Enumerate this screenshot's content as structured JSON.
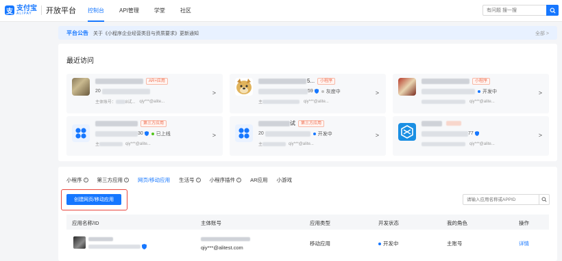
{
  "brand": {
    "logo_cn": "支付宝",
    "logo_en": "ALIPAY",
    "platform": "开放平台",
    "color": "#1677ff"
  },
  "nav": {
    "items": [
      {
        "label": "控制台",
        "active": true
      },
      {
        "label": "API管理",
        "active": false
      },
      {
        "label": "学堂",
        "active": false
      },
      {
        "label": "社区",
        "active": false
      }
    ]
  },
  "search": {
    "placeholder": "有问题 搜一搜",
    "icon": "search-icon"
  },
  "notice": {
    "tag": "平台公告",
    "text": "关于《小程序企业经营类目与资质要求》更新通知",
    "more": "全部 >"
  },
  "recent": {
    "title": "最近访问",
    "cards": [
      {
        "tag": "AR+应用",
        "id_prefix": "20",
        "status": "",
        "owner_prefix": "主体账号：",
        "owner_mid": "8试...",
        "email": "qiy***@alite..."
      },
      {
        "tag": "小程序",
        "id_prefix": "",
        "id_suffix": "59",
        "status": "灰度中",
        "status_color": "#bfbfbf",
        "owner_prefix": "主",
        "email": "qiy***@alite..."
      },
      {
        "tag": "小程序",
        "id_prefix": "",
        "status": "开发中",
        "status_color": "#1677ff",
        "owner_prefix": "",
        "email": "qiy***@alite..."
      },
      {
        "tag": "第三方应用",
        "id_prefix": "",
        "id_suffix": "30",
        "status": "已上线",
        "status_color": "#52c41a",
        "owner_prefix": "主",
        "email": "qiy***@alite..."
      },
      {
        "tag": "第三方应用",
        "name_suffix": "试",
        "id_prefix": "20",
        "status": "开发中",
        "status_color": "#1677ff",
        "owner_prefix": "主",
        "email": "qiy***@alite..."
      },
      {
        "tag": "",
        "id_suffix": "77",
        "status": "",
        "owner_prefix": "",
        "email": "qiy***@alite..."
      }
    ]
  },
  "apps": {
    "tabs": [
      {
        "label": "小程序",
        "info": true,
        "active": false
      },
      {
        "label": "第三方应用",
        "info": true,
        "active": false
      },
      {
        "label": "网页/移动应用",
        "info": false,
        "active": true
      },
      {
        "label": "生活号",
        "info": true,
        "active": false
      },
      {
        "label": "小程序插件",
        "info": true,
        "active": false
      },
      {
        "label": "AR应用",
        "info": false,
        "active": false
      },
      {
        "label": "小游戏",
        "info": false,
        "active": false
      }
    ],
    "create_button": "创建网页/移动应用",
    "search_placeholder": "请输入应用名称或APPID",
    "columns": {
      "name": "应用名称/ID",
      "owner": "主体账号",
      "type": "应用类型",
      "dev_status": "开发状态",
      "role": "我的角色",
      "ops": "操作"
    },
    "rows": [
      {
        "owner_email": "qiy***@alitest.com",
        "type": "移动应用",
        "dev_status": "开发中",
        "role": "主账号",
        "op": "详情"
      }
    ]
  }
}
